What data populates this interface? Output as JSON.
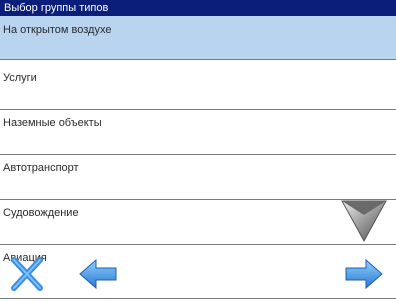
{
  "window": {
    "title": "Выбор группы типов"
  },
  "list": {
    "items": [
      {
        "label": "На открытом воздухе",
        "selected": true
      },
      {
        "label": "Услуги",
        "selected": false
      },
      {
        "label": "Наземные объекты",
        "selected": false
      },
      {
        "label": "Автотранспорт",
        "selected": false
      },
      {
        "label": "Судовождение",
        "selected": false
      },
      {
        "label": "Авиация",
        "selected": false
      }
    ]
  },
  "colors": {
    "title_bg": "#0b1f7a",
    "selected_row": "#b8d4ee",
    "icon_blue": "#3a8ee6"
  },
  "icons": {
    "close": "close-icon",
    "prev": "arrow-left-icon",
    "next": "arrow-right-icon",
    "scroll_down": "arrow-down-icon"
  }
}
